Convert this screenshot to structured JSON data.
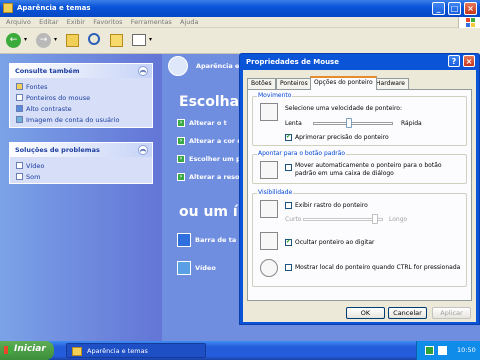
{
  "window": {
    "title": "Aparência e temas"
  },
  "menu": [
    "Arquivo",
    "Editar",
    "Exibir",
    "Favoritos",
    "Ferramentas",
    "Ajuda"
  ],
  "sidebar": {
    "see_also": {
      "title": "Consulte também",
      "items": [
        "Fontes",
        "Ponteiros do mouse",
        "Alto contraste",
        "Imagem de conta do usuário"
      ]
    },
    "troubleshoot": {
      "title": "Soluções de problemas",
      "items": [
        "Vídeo",
        "Som"
      ]
    }
  },
  "content": {
    "header_label": "Aparência e t",
    "pick_task": "Escolha",
    "tasks": [
      "Alterar o t",
      "Alterar a cor d",
      "Escolher um pr",
      "Alterar a resol"
    ],
    "or_pick": "ou um í",
    "icons": [
      "Barra de ta",
      "Vídeo"
    ]
  },
  "dialog": {
    "title": "Propriedades de Mouse",
    "tabs": [
      "Botões",
      "Ponteiros",
      "Opções do ponteiro",
      "Hardware"
    ],
    "selected_tab": "Opções do ponteiro",
    "motion": {
      "legend": "Movimento",
      "prompt": "Selecione uma velocidade de ponteiro:",
      "slow": "Lenta",
      "fast": "Rápida",
      "speed": 0.45,
      "precision_label": "Aprimorar precisão do ponteiro",
      "precision_checked": true
    },
    "snap": {
      "legend": "Apontar para o botão padrão",
      "label": "Mover automaticamente o ponteiro para o botão padrão em uma caixa de diálogo",
      "checked": false
    },
    "visibility": {
      "legend": "Visibilidade",
      "trails_label": "Exibir rastro do ponteiro",
      "trails_checked": false,
      "short": "Curto",
      "long": "Longo",
      "trails_level": 0.9,
      "hide_label": "Ocultar ponteiro ao digitar",
      "hide_checked": true,
      "ctrl_label": "Mostrar local do ponteiro quando CTRL for pressionada",
      "ctrl_checked": false
    },
    "buttons": {
      "ok": "OK",
      "cancel": "Cancelar",
      "apply": "Aplicar"
    }
  },
  "taskbar": {
    "start": "Iniciar",
    "item": "Aparência e temas",
    "clock": "10:50"
  }
}
